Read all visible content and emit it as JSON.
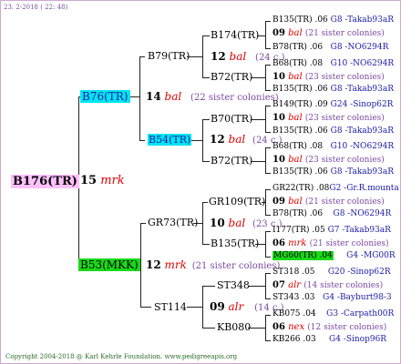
{
  "header": {
    "date": "23.  2-2018 ( 22: 48)"
  },
  "root": {
    "name": "B176(TR)"
  },
  "gen1": [
    {
      "name": "B76(TR)",
      "year": "14",
      "breeder": "bal",
      "sisters": "(22 sister colonies)"
    },
    {
      "name": "B53(MKK)",
      "year": "12",
      "breeder": "mrk",
      "sisters": "(21 sister colonies)"
    }
  ],
  "root_line": {
    "year": "15",
    "breeder": "mrk"
  },
  "gen2": [
    {
      "name": "B79(TR)",
      "year": "",
      "breeder": "",
      "sisters": ""
    },
    {
      "name": "B54(TR)",
      "year": "12",
      "breeder": "bal",
      "sisters": "(24 c.)"
    },
    {
      "name": "GR73(TR)",
      "year": "10",
      "breeder": "bal",
      "sisters": "(23 c.)"
    },
    {
      "name": "ST114",
      "year": "09",
      "breeder": "alr",
      "sisters": "(14 c.)"
    }
  ],
  "gen3": [
    {
      "name": "B174(TR)",
      "year": "12",
      "breeder": "bal",
      "sisters": "(24 c.)"
    },
    {
      "name": "B72(TR)"
    },
    {
      "name": "B70(TR)"
    },
    {
      "name": "B72(TR)"
    },
    {
      "name": "GR109(TR)"
    },
    {
      "name": "B135(TR)"
    },
    {
      "name": "ST348"
    },
    {
      "name": "KB080"
    }
  ],
  "gen4": [
    {
      "id": "B135(TR) .06",
      "tag": "G8 -Takab93aR"
    },
    {
      "year": "09",
      "breeder": "bal",
      "sisters": "(21 sister colonies)"
    },
    {
      "id": "B78(TR) .06",
      "tag": "G8 -NO6294R"
    },
    {
      "id": "B68(TR) .08",
      "tag": "G10 -NO6294R"
    },
    {
      "year": "10",
      "breeder": "bal",
      "sisters": "(23 sister colonies)"
    },
    {
      "id": "B135(TR) .06",
      "tag": "G8 -Takab93aR"
    },
    {
      "id": "B149(TR) .09",
      "tag": "G24 -Sinop62R"
    },
    {
      "year": "10",
      "breeder": "bal",
      "sisters": "(23 sister colonies)"
    },
    {
      "id": "B135(TR) .06",
      "tag": "G8 -Takab93aR"
    },
    {
      "id": "B68(TR) .08",
      "tag": "G10 -NO6294R"
    },
    {
      "year": "10",
      "breeder": "bal",
      "sisters": "(23 sister colonies)"
    },
    {
      "id": "B135(TR) .06",
      "tag": "G8 -Takab93aR"
    },
    {
      "id": "GR22(TR) .08",
      "tag": "G2 -Gr.R.mounta"
    },
    {
      "year": "09",
      "breeder": "bal",
      "sisters": "(21 sister colonies)"
    },
    {
      "id": "B78(TR) .06",
      "tag": "G8 -NO6294R"
    },
    {
      "id": "I177(TR) .05",
      "tag": "G7 -Takab93aR"
    },
    {
      "year": "06",
      "breeder": "mrk",
      "sisters": "(21 sister colonies)"
    },
    {
      "id": "MG60(TR) .04",
      "tag": "G4 -MG00R"
    },
    {
      "id": "ST318 .05",
      "tag": "G20 -Sinop62R"
    },
    {
      "year": "07",
      "breeder": "alr",
      "sisters": "(14 sister colonies)"
    },
    {
      "id": "ST343 .03",
      "tag": "G4 -Bayburt98-3"
    },
    {
      "id": "KB075 .04",
      "tag": "G3 -Carpath00R"
    },
    {
      "year": "06",
      "breeder": "nex",
      "sisters": "(12 sister colonies)"
    },
    {
      "id": "KB266 .03",
      "tag": "G4 -Sinop96R"
    }
  ],
  "footer": {
    "text": "Copyright 2004-2018 @ Karl Kehrle Foundation.   www.pedigreeapis.org"
  },
  "colors": {
    "root_bg": "#ffc0ff",
    "b76_bg": "#00e5f0",
    "b54_bg": "#00e5f0",
    "b53_bg": "#19d919",
    "mg60_bg": "#19d919",
    "blue": "#1a1aa6",
    "red": "#e00000"
  }
}
